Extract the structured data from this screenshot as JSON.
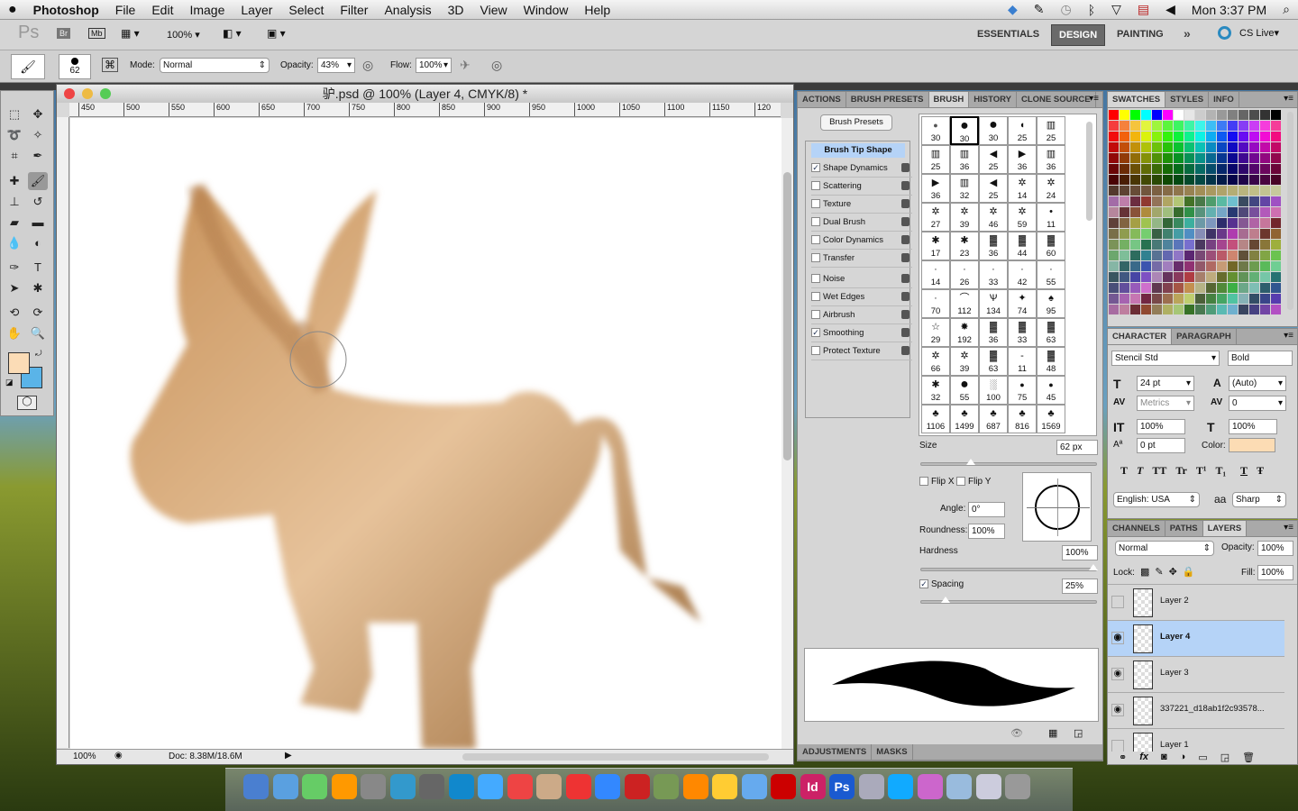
{
  "menubar": {
    "apple": "",
    "app": "Photoshop",
    "items": [
      "File",
      "Edit",
      "Image",
      "Layer",
      "Select",
      "Filter",
      "Analysis",
      "3D",
      "View",
      "Window",
      "Help"
    ],
    "clock": "Mon 3:37 PM"
  },
  "appbar": {
    "logo": "Ps",
    "bridge": "Br",
    "minibridge": "Mb",
    "zoom": "100%",
    "workspaces": [
      "ESSENTIALS",
      "DESIGN",
      "PAINTING"
    ],
    "active_workspace": "DESIGN",
    "more": "»",
    "cslive": "CS Live"
  },
  "options": {
    "brush_size": "62",
    "mode_label": "Mode:",
    "mode": "Normal",
    "opacity_label": "Opacity:",
    "opacity": "43%",
    "flow_label": "Flow:",
    "flow": "100%"
  },
  "document": {
    "title": "驴.psd @ 100% (Layer 4, CMYK/8) *",
    "ruler_ticks": [
      "450",
      "500",
      "550",
      "600",
      "650",
      "700",
      "750",
      "800",
      "850",
      "900",
      "950",
      "1000",
      "1050",
      "1100",
      "1150",
      "120"
    ],
    "zoom": "100%",
    "doc_info": "Doc: 8.38M/18.6M"
  },
  "colors": {
    "foreground": "#fbdcb6",
    "background": "#5ab4e8",
    "selected_layer": "#b5d3f7",
    "char_color": "#fcdcb4"
  },
  "brush_panel": {
    "tabs": [
      "ACTIONS",
      "BRUSH PRESETS",
      "BRUSH",
      "HISTORY",
      "CLONE SOURCE"
    ],
    "active_tab": "BRUSH",
    "presets_button": "Brush Presets",
    "tip_shape": "Brush Tip Shape",
    "options": [
      {
        "label": "Shape Dynamics",
        "checked": true
      },
      {
        "label": "Scattering",
        "checked": false
      },
      {
        "label": "Texture",
        "checked": false
      },
      {
        "label": "Dual Brush",
        "checked": false
      },
      {
        "label": "Color Dynamics",
        "checked": false
      },
      {
        "label": "Transfer",
        "checked": false
      },
      {
        "label": "Noise",
        "checked": false
      },
      {
        "label": "Wet Edges",
        "checked": false
      },
      {
        "label": "Airbrush",
        "checked": false
      },
      {
        "label": "Smoothing",
        "checked": true
      },
      {
        "label": "Protect Texture",
        "checked": false
      }
    ],
    "sizes": [
      "30",
      "30",
      "30",
      "25",
      "25",
      "25",
      "36",
      "25",
      "36",
      "36",
      "36",
      "32",
      "25",
      "14",
      "24",
      "27",
      "39",
      "46",
      "59",
      "11",
      "17",
      "23",
      "36",
      "44",
      "60",
      "14",
      "26",
      "33",
      "42",
      "55",
      "70",
      "112",
      "134",
      "74",
      "95",
      "29",
      "192",
      "36",
      "33",
      "63",
      "66",
      "39",
      "63",
      "11",
      "48",
      "32",
      "55",
      "100",
      "75",
      "45",
      "1106",
      "1499",
      "687",
      "816",
      "1569"
    ],
    "size_label": "Size",
    "size": "62 px",
    "flip_x": "Flip X",
    "flip_y": "Flip Y",
    "angle_label": "Angle:",
    "angle": "0°",
    "roundness_label": "Roundness:",
    "roundness": "100%",
    "hardness_label": "Hardness",
    "hardness": "100%",
    "spacing_label": "Spacing",
    "spacing": "25%",
    "size_level": 0.27,
    "hardness_level": 1.0,
    "spacing_level": 0.12
  },
  "adjustments": {
    "tabs": [
      "ADJUSTMENTS",
      "MASKS"
    ]
  },
  "swatches": {
    "tabs": [
      "SWATCHES",
      "STYLES",
      "INFO"
    ]
  },
  "character": {
    "tabs": [
      "CHARACTER",
      "PARAGRAPH"
    ],
    "font": "Stencil Std",
    "style": "Bold",
    "size": "24 pt",
    "leading": "(Auto)",
    "kerning": "Metrics",
    "tracking": "0",
    "vscale": "100%",
    "hscale": "100%",
    "baseline": "0 pt",
    "color_label": "Color:",
    "styles": [
      "T",
      "T",
      "TT",
      "Tr",
      "T¹",
      "T₁",
      "T",
      "Ŧ"
    ],
    "language": "English: USA",
    "aa_icon": "aa",
    "antialias": "Sharp"
  },
  "layers": {
    "tabs": [
      "CHANNELS",
      "PATHS",
      "LAYERS"
    ],
    "blend": "Normal",
    "opacity_label": "Opacity:",
    "opacity": "100%",
    "lock_label": "Lock:",
    "fill_label": "Fill:",
    "fill": "100%",
    "items": [
      {
        "name": "Layer 2",
        "visible": false
      },
      {
        "name": "Layer 4",
        "visible": true,
        "selected": true
      },
      {
        "name": "Layer 3",
        "visible": true
      },
      {
        "name": "337221_d18ab1f2c93578...",
        "visible": true
      },
      {
        "name": "Layer 1",
        "visible": false
      }
    ]
  },
  "dock": [
    "finder",
    "dashboard",
    "app-store-cube",
    "app-launcher",
    "preview",
    "wordpress",
    "system-prefs",
    "app-store",
    "safari",
    "chrome",
    "stickies",
    "ical",
    "itunes",
    "photo-booth",
    "iphoto",
    "vlc",
    "paint",
    "mail",
    "acrobat",
    "indesign",
    "photoshop",
    "tool",
    "skype",
    "pinwheel",
    "folder",
    "folder-2",
    "trash"
  ]
}
